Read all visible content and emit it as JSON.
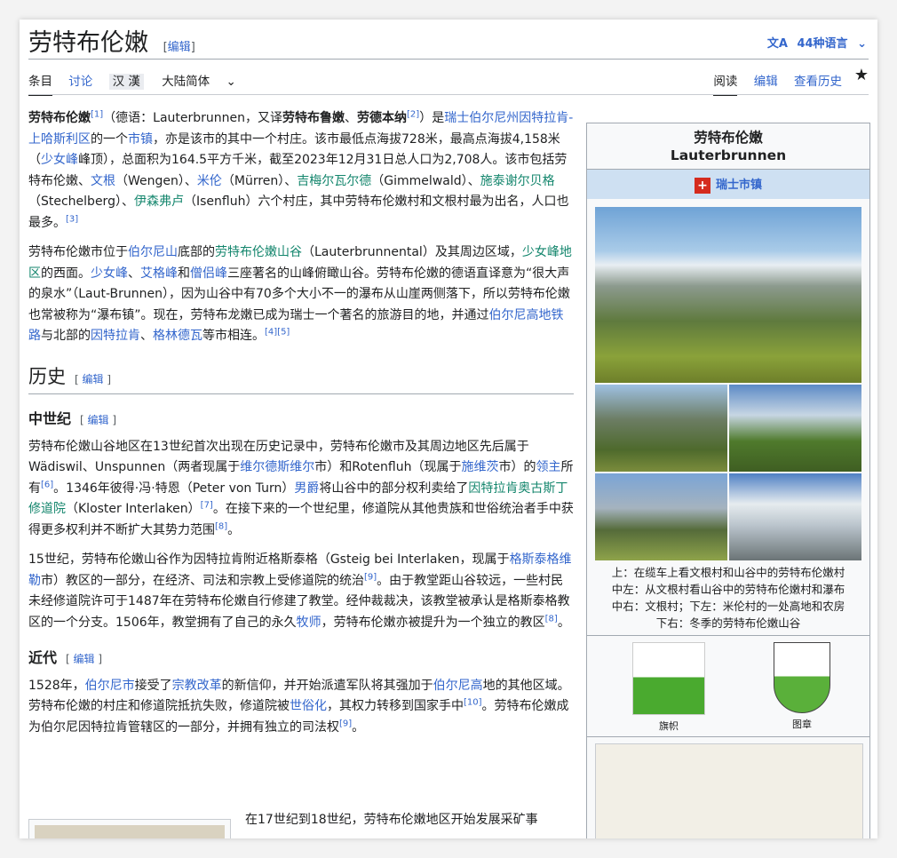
{
  "header": {
    "title": "劳特布伦嫩",
    "edit_open": "[",
    "edit_label": "编辑",
    "edit_close": "]",
    "lang_icon": "文A",
    "languages": "44种语言",
    "lang_chevron": "⌄"
  },
  "tabs": {
    "article": "条目",
    "talk": "讨论",
    "hanzi": "汉 漢",
    "variant": "大陆简体",
    "read": "阅读",
    "edit": "编辑",
    "history": "查看历史",
    "watch": "★"
  },
  "p1": {
    "a1": "劳特布伦嫩",
    "s1": "[1]",
    "a2": "（德语：Lauterbrunnen，又译",
    "a3": "劳特布鲁嫩",
    "a4": "、",
    "a5": "劳德本纳",
    "s2": "[2]",
    "a6": "）是",
    "l1": "瑞士伯尔尼州因特拉肯-上哈斯利区",
    "a7": "的一个",
    "l2": "市镇",
    "a8": "，亦是该市的其中一个村庄。该市最低点海拔728米，最高点海拔4,158米（",
    "l3": "少女峰",
    "a9": "峰顶），总面积为164.5平方千米，截至2023年12月31日总人口为2,708人。该市包括劳特布伦嫩、",
    "l4": "文根",
    "a10": "（Wengen）、",
    "l5": "米伦",
    "a11": "（Mürren）、",
    "g1": "吉梅尔瓦尔德",
    "a12": "（Gimmelwald）、",
    "g2": "施泰谢尔贝格",
    "a13": "（Stechelberg）、",
    "g3": "伊森弗卢",
    "a14": "（Isenfluh）六个村庄，其中劳特布伦嫩村和文根村最为出名，人口也最多。",
    "s3": "[3]"
  },
  "p2": {
    "a1": "劳特布伦嫩市位于",
    "l1": "伯尔尼山",
    "a2": "底部的",
    "g1": "劳特布伦嫩山谷",
    "a3": "（Lauterbrunnental）及其周边区域，",
    "g2": "少女峰地区",
    "a4": "的西面。",
    "l2": "少女峰",
    "a5": "、",
    "l3": "艾格峰",
    "a6": "和",
    "l4": "僧侣峰",
    "a7": "三座著名的山峰俯瞰山谷。劳特布伦嫩的德语直译意为“很大声的泉水”（Laut-Brunnen），因为山谷中有70多个大小不一的瀑布从山崖两侧落下，所以劳特布伦嫩也常被称为“瀑布镇”。现在，劳特布龙嫩已成为瑞士一个著名的旅游目的地，并通过",
    "l5": "伯尔尼高地铁路",
    "a8": "与北部的",
    "l6": "因特拉肯",
    "a9": "、",
    "l7": "格林德瓦",
    "a10": "等市相连。",
    "s1": "[4][5]"
  },
  "h_history": "历史",
  "h_middle": "中世纪",
  "p3": {
    "a1": "劳特布伦嫩山谷地区在13世纪首次出现在历史记录中，劳特布伦嫩市及其周边地区先后属于Wädiswil、Unspunnen（两者现属于",
    "l1": "维尔德斯维尔",
    "a2": "市）和Rotenfluh（现属于",
    "l2": "施维茨",
    "a3": "市）的",
    "l3": "领主",
    "a4": "所有",
    "s1": "[6]",
    "a5": "。1346年彼得·冯·特恩（Peter von Turn）",
    "l4": "男爵",
    "a6": "将山谷中的部分权利卖给了",
    "g1": "因特拉肯奥古斯丁修道院",
    "a7": "（Kloster Interlaken）",
    "s2": "[7]",
    "a8": "。在接下来的一个世纪里，修道院从其他贵族和世俗统治者手中获得更多权利并不断扩大其势力范围",
    "s3": "[8]",
    "a9": "。"
  },
  "p4": {
    "a1": "15世纪，劳特布伦嫩山谷作为因特拉肯附近格斯泰格（Gsteig bei Interlaken，现属于",
    "l1": "格斯泰格维勒",
    "a2": "市）教区的一部分，在经济、司法和宗教上受修道院的统治",
    "s1": "[9]",
    "a3": "。由于教堂距山谷较远，一些村民未经修道院许可于1487年在劳特布伦嫩自行修建了教堂。经仲裁裁决，该教堂被承认是格斯泰格教区的一个分支。1506年，教堂拥有了自己的永久",
    "l2": "牧师",
    "a4": "，劳特布伦嫩亦被提升为一个独立的教区",
    "s2": "[8]",
    "a5": "。"
  },
  "h_modern": "近代",
  "p5": {
    "a1": "1528年，",
    "l1": "伯尔尼市",
    "a2": "接受了",
    "l2": "宗教改革",
    "a3": "的新信仰，并开始派遣军队将其强加于",
    "l3": "伯尔尼高",
    "a4": "地的其他区域。劳特布伦嫩的村庄和修道院抵抗失败，修道院被",
    "l4": "世俗化",
    "a5": "，其权力转移到国家手中",
    "s1": "[10]",
    "a6": "。劳特布伦嫩成为伯尔尼因特拉肯管辖区的一部分，并拥有独立的司法权",
    "s2": "[9]",
    "a7": "。"
  },
  "p6": {
    "a1": "在17世纪到18世纪，劳特布伦嫩地区开始发展采矿事"
  },
  "infobox": {
    "title_zh": "劳特布伦嫩",
    "title_de": "Lauterbrunnen",
    "flag_glyph": "+",
    "type": "瑞士市镇",
    "caption1": "上：在缆车上看文根村和山谷中的劳特布伦嫩村",
    "caption2": "中左：从文根村看山谷中的劳特布伦嫩村和瀑布",
    "caption3": "中右：文根村；下左：米伦村的一处高地和农房",
    "caption4": "下右：冬季的劳特布伦嫩山谷",
    "flag_label": "旗帜",
    "coat_label": "图章"
  }
}
